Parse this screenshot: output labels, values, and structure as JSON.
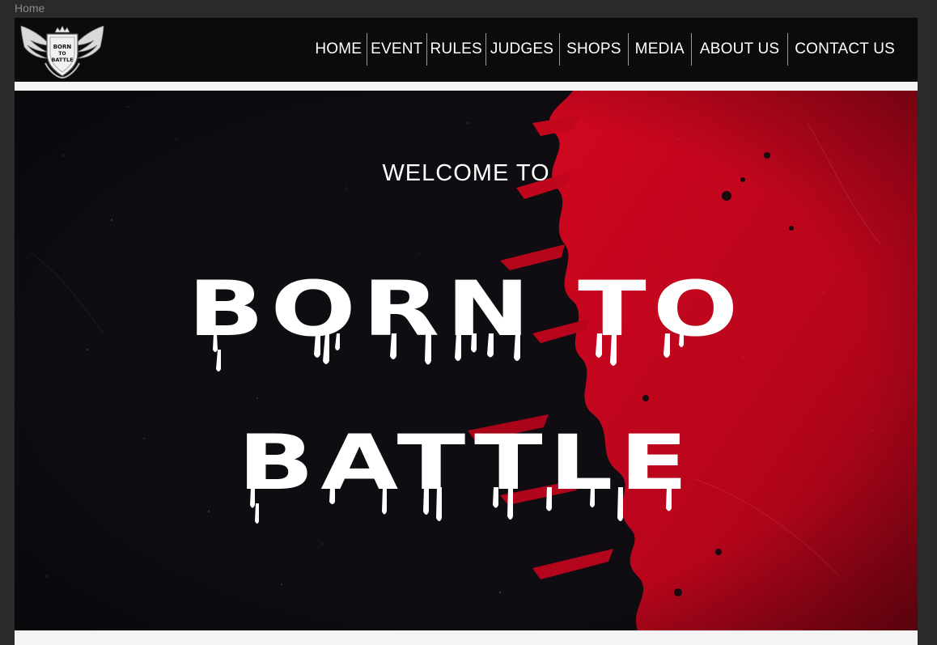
{
  "page": {
    "label": "Home"
  },
  "header": {
    "logo_text": [
      "BORN",
      "TO",
      "BATTLE"
    ],
    "nav": [
      {
        "label": "HOME"
      },
      {
        "label": "EVENT"
      },
      {
        "label": "RULES"
      },
      {
        "label": "JUDGES"
      },
      {
        "label": "SHOPS"
      },
      {
        "label": "MEDIA"
      },
      {
        "label": "ABOUT US"
      },
      {
        "label": "CONTACT US"
      }
    ]
  },
  "hero": {
    "welcome": "WELCOME TO",
    "title_line1": "BORN TO",
    "title_line2": "BATTLE"
  },
  "colors": {
    "nav_bg": "#0b0b0b",
    "hero_dark": "#0d0b10",
    "hero_red": "#c0061f",
    "text": "#ffffff"
  }
}
